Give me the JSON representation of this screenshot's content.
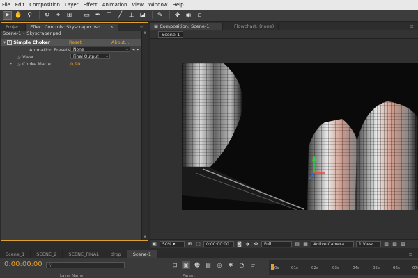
{
  "menu": [
    "File",
    "Edit",
    "Composition",
    "Layer",
    "Effect",
    "Animation",
    "View",
    "Window",
    "Help"
  ],
  "toolbar": {
    "tools": [
      "selection-tool",
      "hand-tool",
      "zoom-tool",
      "rotate-tool",
      "camera-tool",
      "pan-behind-tool",
      "rectangle-tool",
      "pen-tool",
      "type-tool",
      "brush-tool",
      "clone-stamp-tool",
      "eraser-tool",
      "roto-brush-tool",
      "puppet-tool"
    ]
  },
  "left_panel": {
    "tabs": [
      "Project",
      "Effect Controls: Skyscraper.psd"
    ],
    "header": "Scene-1 • Skyscraper.psd",
    "effect_name": "Simple Choker",
    "reset_label": "Reset",
    "about_label": "About...",
    "presets_label": "Animation Presets:",
    "presets_value": "None",
    "view_label": "View",
    "view_value": "Final Output",
    "choke_label": "Choke Matte",
    "choke_value": "0,90"
  },
  "right_panel": {
    "tabs": [
      "Composition: Scene-1",
      "Flowchart: (none)"
    ],
    "subtab": "Scene-1",
    "footer": {
      "zoom": "50%",
      "timecode": "0:00:00:00",
      "resolution": "Full",
      "camera": "Active Camera",
      "views": "1 View"
    }
  },
  "timeline": {
    "tabs": [
      "Scene_1",
      "SCENE_2",
      "SCENE_FINAL",
      "drop",
      "Scene-1"
    ],
    "timecode": "0:00:00:00",
    "ruler_labels": [
      "0s",
      "01s",
      "02s",
      "03s",
      "04s",
      "05s",
      "06s",
      "07s"
    ],
    "column_title": "Layer Name",
    "parent_title": "Parent"
  },
  "colors": {
    "accent": "#e0a030",
    "panel_bg": "#3a3a3a",
    "menu_bg": "#e8e8e8"
  }
}
